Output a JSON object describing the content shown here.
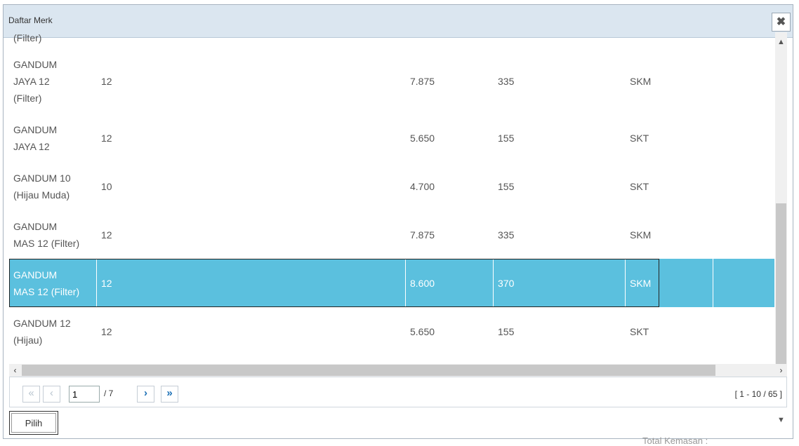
{
  "dialog": {
    "title": "Daftar Merk",
    "close_icon": "close-icon"
  },
  "grid": {
    "partial_top_label": "(Filter)",
    "rows": [
      {
        "name": [
          "GANDUM",
          "JAYA 12",
          "(Filter)"
        ],
        "isi": "12",
        "harga": "7.875",
        "tarif": "335",
        "jenis": "SKM",
        "selected": false
      },
      {
        "name": [
          "GANDUM",
          "JAYA 12"
        ],
        "isi": "12",
        "harga": "5.650",
        "tarif": "155",
        "jenis": "SKT",
        "selected": false
      },
      {
        "name": [
          "GANDUM 10",
          "(Hijau Muda)"
        ],
        "isi": "10",
        "harga": "4.700",
        "tarif": "155",
        "jenis": "SKT",
        "selected": false
      },
      {
        "name": [
          "GANDUM",
          "MAS 12 (Filter)"
        ],
        "isi": "12",
        "harga": "7.875",
        "tarif": "335",
        "jenis": "SKM",
        "selected": false
      },
      {
        "name": [
          "GANDUM",
          "MAS 12 (Filter)"
        ],
        "isi": "12",
        "harga": "8.600",
        "tarif": "370",
        "jenis": "SKM",
        "selected": true
      },
      {
        "name": [
          "GANDUM 12",
          "(Hijau)"
        ],
        "isi": "12",
        "harga": "5.650",
        "tarif": "155",
        "jenis": "SKT",
        "selected": false
      }
    ]
  },
  "pager": {
    "first_label": "«",
    "prev_label": "‹",
    "current_page": "1",
    "total_pages": "/ 7",
    "next_label": "›",
    "last_label": "»",
    "range": "[ 1 - 10 / 65 ]"
  },
  "footer": {
    "pilih_label": "Pilih"
  },
  "background": {
    "partial_label": "Total Kemasan :"
  },
  "colors": {
    "selected_row": "#5bc0de",
    "titlebar": "#dbe6f0",
    "pager_active": "#1a6fb5"
  }
}
